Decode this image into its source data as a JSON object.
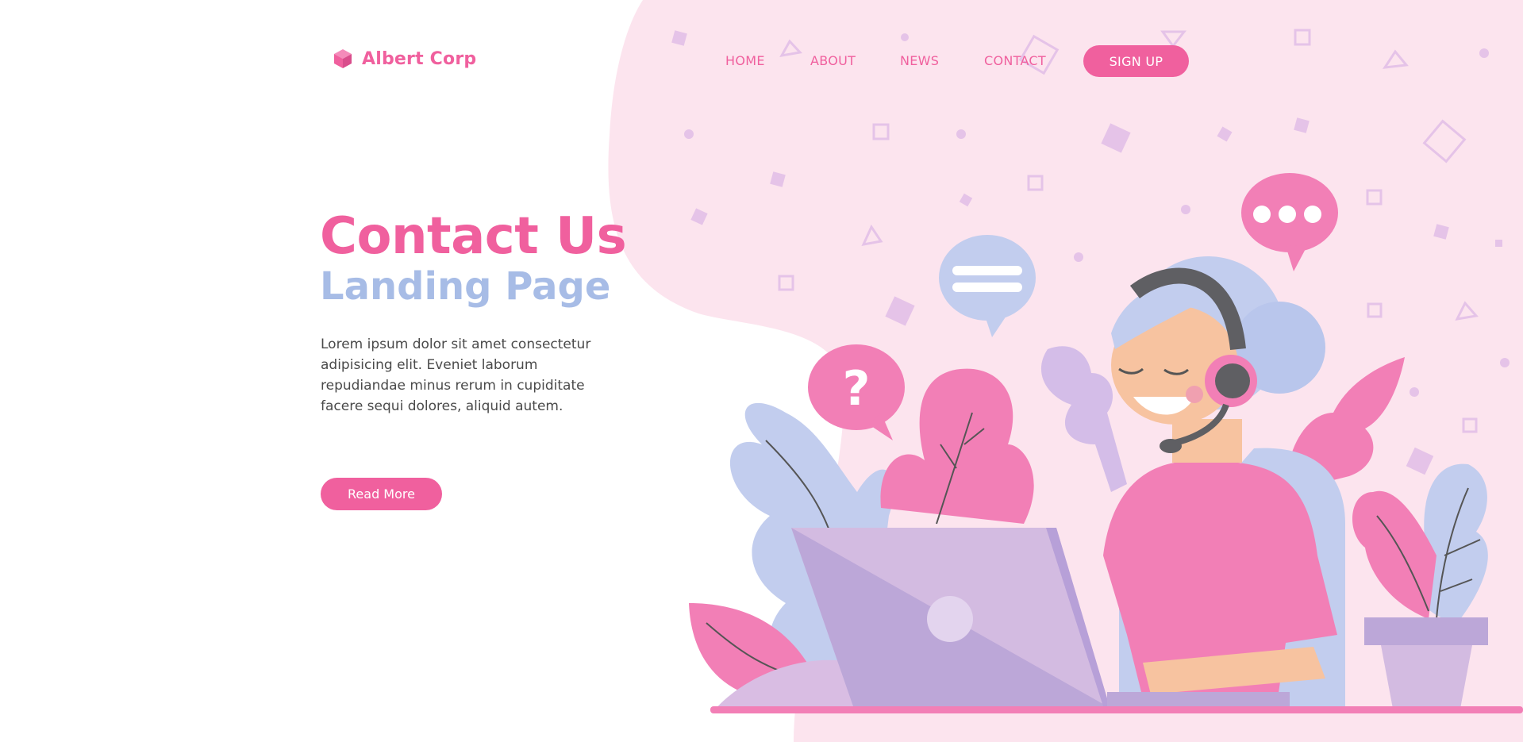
{
  "brand": {
    "name": "Albert Corp",
    "logo_icon": "cube-icon"
  },
  "nav": {
    "items": [
      "HOME",
      "ABOUT",
      "NEWS",
      "CONTACT"
    ],
    "signup_label": "SIGN UP"
  },
  "hero": {
    "title": "Contact Us",
    "subtitle": "Landing Page",
    "body": "Lorem ipsum dolor sit amet consectetur adipisicing elit. Eveniet laborum repudiandae minus rerum in cupiditate facere sequi dolores, aliquid autem.",
    "cta_label": "Read More"
  },
  "illustration": {
    "icons": [
      "question-bubble-icon",
      "menu-bubble-icon",
      "ellipsis-bubble-icon",
      "headset-icon",
      "laptop-icon",
      "plant-icon"
    ]
  },
  "colors": {
    "accent": "#f0609e",
    "subtitle": "#a7bce6",
    "blob": "#fce4ee",
    "lavender": "#c9a9dd",
    "periwinkle": "#c2cdee"
  }
}
